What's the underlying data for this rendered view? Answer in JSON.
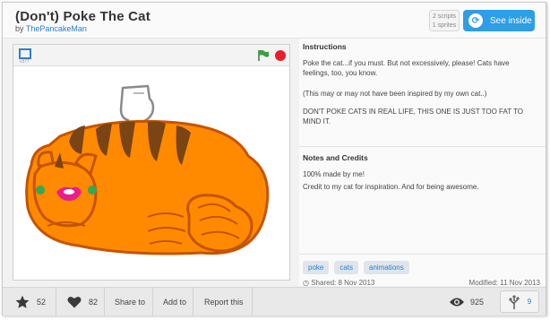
{
  "project": {
    "title": "(Don't) Poke The Cat",
    "by_label": "by",
    "author": "ThePancakeMan",
    "scripts_count": "2 scripts",
    "sprites_count": "1 sprites",
    "see_inside_label": "See inside"
  },
  "player": {
    "version": "v377"
  },
  "instructions": {
    "heading": "Instructions",
    "p1": "Poke the cat...if you must. But not excessively, please! Cats have feelings, too, you know.",
    "p2": "(This may or may not have been inspired by my own cat..)",
    "p3": "DON'T POKE CATS IN REAL LIFE, THIS ONE IS JUST TOO FAT TO MIND IT."
  },
  "notes": {
    "heading": "Notes and Credits",
    "line1": "100% made by me!",
    "line2": "Credit to my cat for inspiration. And for being awesome."
  },
  "tags": [
    "poke",
    "cats",
    "animations"
  ],
  "dates": {
    "shared": "Shared: 8 Nov 2013",
    "modified": "Modified: 11 Nov 2013"
  },
  "footer": {
    "favorites": "52",
    "loves": "82",
    "share_label": "Share to",
    "add_label": "Add to",
    "report_label": "Report this",
    "views": "925",
    "remixes": "9"
  },
  "colors": {
    "accent": "#2e9ee6",
    "link": "#2c7fcf",
    "cat_body": "#ff8a00",
    "cat_outline": "#c55400",
    "stripes": "#7a4414"
  }
}
